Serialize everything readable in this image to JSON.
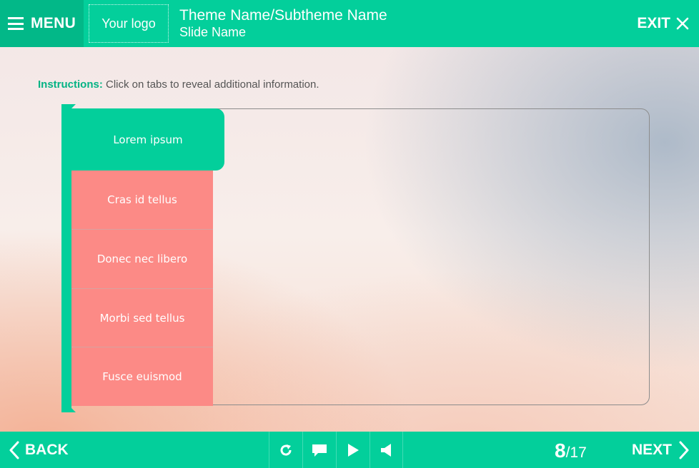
{
  "header": {
    "menu_label": "MENU",
    "logo_text": "Your logo",
    "theme_title": "Theme Name/Subtheme Name",
    "slide_name": "Slide Name",
    "exit_label": "EXIT"
  },
  "instructions": {
    "prefix": "Instructions:",
    "text": " Click on tabs to reveal additional information."
  },
  "tabs": [
    {
      "label": "Lorem ipsum",
      "active": true
    },
    {
      "label": "Cras id tellus",
      "active": false
    },
    {
      "label": "Donec nec libero",
      "active": false
    },
    {
      "label": "Morbi sed tellus",
      "active": false
    },
    {
      "label": "Fusce euismod",
      "active": false
    }
  ],
  "footer": {
    "back_label": "BACK",
    "next_label": "NEXT",
    "page_current": "8",
    "page_total": "/17",
    "controls": [
      "reload-icon",
      "comment-icon",
      "play-icon",
      "volume-icon"
    ]
  },
  "colors": {
    "accent": "#03cf9b",
    "accent_dark": "#02b888",
    "tab_inactive": "#fc8a86",
    "instruction_label": "#03b384"
  }
}
